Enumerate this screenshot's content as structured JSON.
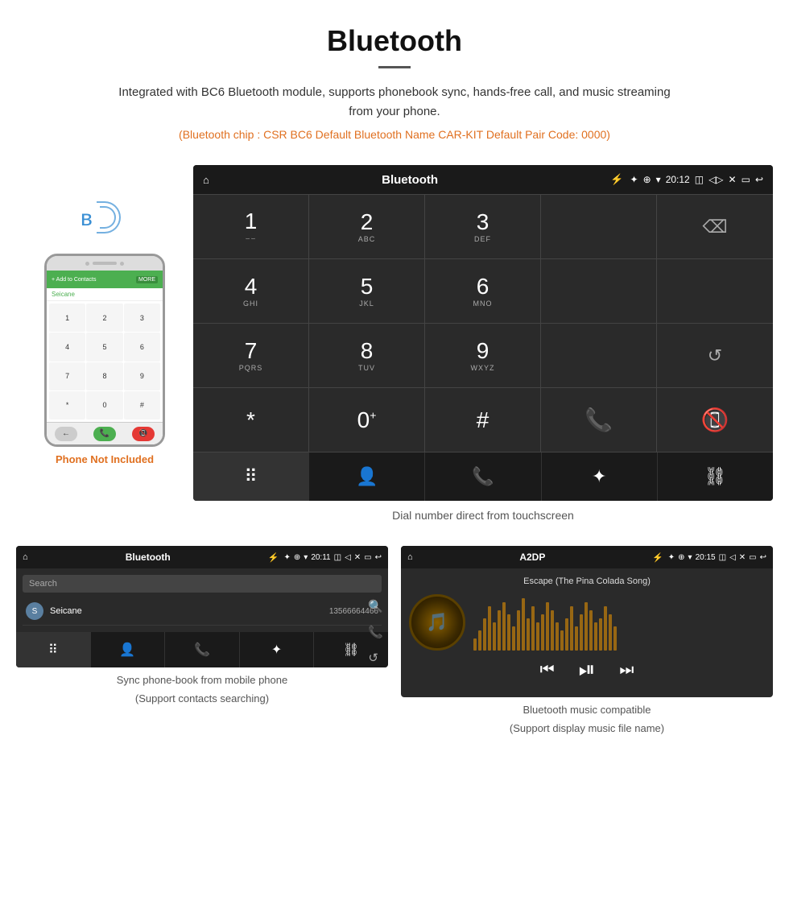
{
  "header": {
    "title": "Bluetooth",
    "description": "Integrated with BC6 Bluetooth module, supports phonebook sync, hands-free call, and music streaming from your phone.",
    "specs": "(Bluetooth chip : CSR BC6    Default Bluetooth Name CAR-KIT    Default Pair Code: 0000)"
  },
  "phone_note": "Phone Not Included",
  "main_screen": {
    "status_bar": {
      "home_icon": "⌂",
      "title": "Bluetooth",
      "usb_icon": "⚡",
      "bt_icon": "✦",
      "location_icon": "⊕",
      "wifi_icon": "▾",
      "time": "20:12",
      "camera_icon": "◫",
      "volume_icon": "◁",
      "x_icon": "✕",
      "window_icon": "▭",
      "back_icon": "↩"
    },
    "dialpad": [
      {
        "main": "1",
        "sub": "⌣⌣"
      },
      {
        "main": "2",
        "sub": "ABC"
      },
      {
        "main": "3",
        "sub": "DEF"
      },
      {
        "main": "",
        "sub": ""
      },
      {
        "main": "⌫",
        "sub": ""
      }
    ],
    "dialpad_row2": [
      {
        "main": "4",
        "sub": "GHI"
      },
      {
        "main": "5",
        "sub": "JKL"
      },
      {
        "main": "6",
        "sub": "MNO"
      },
      {
        "main": "",
        "sub": ""
      },
      {
        "main": "",
        "sub": ""
      }
    ],
    "dialpad_row3": [
      {
        "main": "7",
        "sub": "PQRS"
      },
      {
        "main": "8",
        "sub": "TUV"
      },
      {
        "main": "9",
        "sub": "WXYZ"
      },
      {
        "main": "",
        "sub": ""
      },
      {
        "main": "↺",
        "sub": ""
      }
    ],
    "dialpad_row4": [
      {
        "main": "*",
        "sub": ""
      },
      {
        "main": "0+",
        "sub": ""
      },
      {
        "main": "#",
        "sub": ""
      },
      {
        "main": "📞",
        "sub": ""
      },
      {
        "main": "📵",
        "sub": ""
      }
    ]
  },
  "nav_items": [
    "⠿",
    "👤",
    "📞",
    "✦",
    "⛓"
  ],
  "screen_caption": "Dial number direct from touchscreen",
  "phonebook_screen": {
    "status": {
      "home": "⌂",
      "title": "Bluetooth",
      "usb": "⚡",
      "bt": "✦",
      "loc": "⊕",
      "wifi": "▾",
      "time": "20:11",
      "camera": "◫",
      "vol": "◁",
      "x": "✕",
      "win": "▭",
      "back": "↩"
    },
    "search_placeholder": "Search",
    "contacts": [
      {
        "initial": "S",
        "name": "Seicane",
        "number": "13566664466"
      }
    ],
    "side_icons": [
      "🔍",
      "📞",
      "↺"
    ]
  },
  "phonebook_caption_line1": "Sync phone-book from mobile phone",
  "phonebook_caption_line2": "(Support contacts searching)",
  "music_screen": {
    "status": {
      "home": "⌂",
      "title": "A2DP",
      "usb": "⚡",
      "bt": "✦",
      "loc": "⊕",
      "wifi": "▾",
      "time": "20:15",
      "camera": "◫",
      "vol": "◁",
      "x": "✕",
      "win": "▭",
      "back": "↩"
    },
    "song_title": "Escape (The Pina Colada Song)",
    "music_note": "♪",
    "controls": {
      "prev": "⏮",
      "play_pause": "⏯",
      "next": "⏭"
    },
    "viz_heights": [
      15,
      25,
      40,
      55,
      35,
      50,
      60,
      45,
      30,
      50,
      65,
      40,
      55,
      35,
      45,
      60,
      50,
      35,
      25,
      40,
      55,
      30,
      45,
      60,
      50,
      35,
      40,
      55,
      45,
      30
    ]
  },
  "music_caption_line1": "Bluetooth music compatible",
  "music_caption_line2": "(Support display music file name)",
  "small_nav_items": [
    "⠿",
    "👤",
    "📞",
    "✦",
    "⛓"
  ],
  "watermark": "Seicane"
}
